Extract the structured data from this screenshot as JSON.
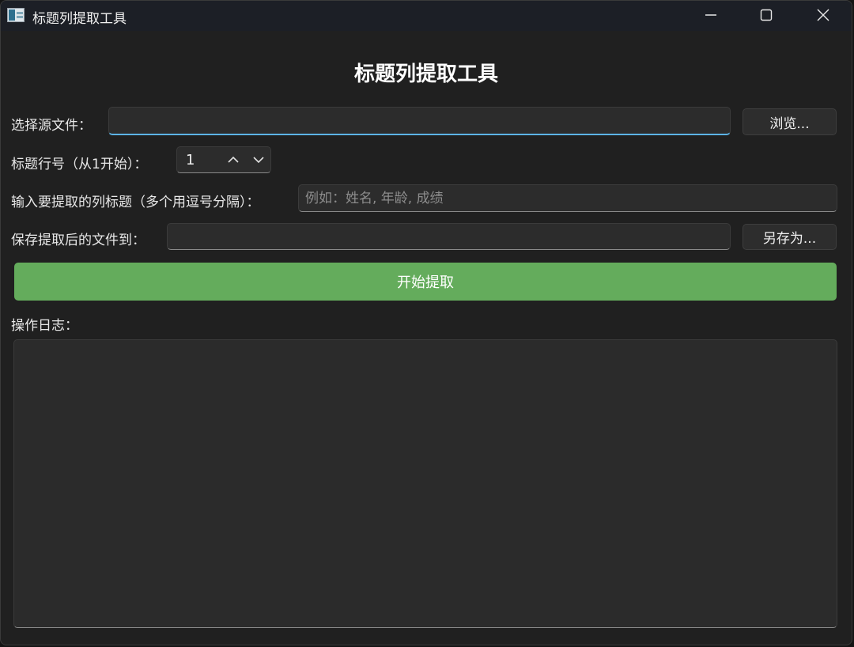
{
  "window": {
    "title": "标题列提取工具"
  },
  "heading": "标题列提取工具",
  "source": {
    "label": "选择源文件：",
    "value": "",
    "placeholder": "",
    "browse_label": "浏览..."
  },
  "header_row": {
    "label": "标题行号（从1开始）：",
    "value": "1"
  },
  "columns": {
    "label": "输入要提取的列标题（多个用逗号分隔）：",
    "value": "",
    "placeholder": "例如：姓名, 年龄, 成绩"
  },
  "save": {
    "label": "保存提取后的文件到：",
    "value": "",
    "placeholder": "",
    "save_as_label": "另存为..."
  },
  "start_label": "开始提取",
  "log": {
    "label": "操作日志：",
    "content": ""
  },
  "colors": {
    "window_bg": "#202020",
    "titlebar_bg": "#1c1f26",
    "accent_focus": "#5cb3e6",
    "start_button": "#64ac5c"
  },
  "icons": {
    "app": "spreadsheet-icon",
    "minimize": "minimize-icon",
    "maximize": "maximize-icon",
    "close": "close-icon",
    "spin_up": "chevron-up-icon",
    "spin_down": "chevron-down-icon"
  }
}
